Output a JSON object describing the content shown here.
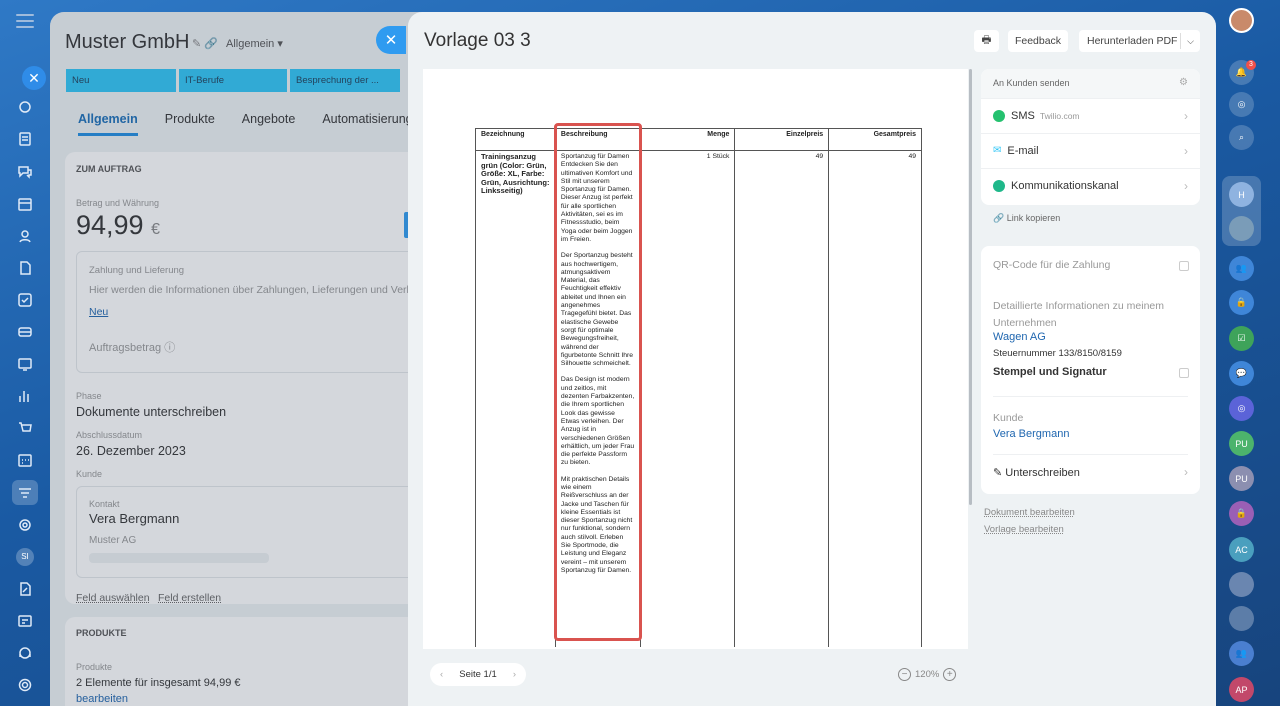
{
  "crm": {
    "title": "Muster GmbH",
    "view": "Allgemein",
    "stages": [
      "Neu",
      "IT-Berufe",
      "Besprechung der ..."
    ],
    "tabs": [
      "Allgemein",
      "Produkte",
      "Angebote",
      "Automatisierung"
    ],
    "order_section": "ZUM AUFTRAG",
    "amount_label": "Betrag und Währung",
    "amount": "94,99",
    "currency": "€",
    "payment_title": "Zahlung und Lieferung",
    "payment_hint": "Hier werden die Informationen über Zahlungen, Lieferungen und Verk",
    "payment_new": "Neu",
    "order_amount_label": "Auftragsbetrag",
    "phase_label": "Phase",
    "phase": "Dokumente unterschreiben",
    "close_date_label": "Abschlussdatum",
    "close_date": "26. Dezember 2023",
    "customer_label": "Kunde",
    "contact_label": "Kontakt",
    "contact_name": "Vera Bergmann",
    "company": "Muster AG",
    "select_field": "Feld auswählen",
    "create_field": "Feld erstellen",
    "products_section": "PRODUKTE",
    "products_label": "Produkte",
    "products_summary": "2 Elemente für insgesamt 94,99 €",
    "products_edit": "bearbeiten"
  },
  "modal": {
    "title": "Vorlage 03 3",
    "feedback": "Feedback",
    "download": "Herunterladen PDF",
    "pager": "Seite 1/1",
    "zoom": "120%"
  },
  "document": {
    "headers": [
      "Bezeichnung",
      "Beschreibung",
      "Menge",
      "Einzelpreis",
      "Gesamtpreis"
    ],
    "item_name": "Trainingsanzug grün (Color: Grün, Größe: XL, Farbe: Grün, Ausrichtung: Linksseitig)",
    "quantity": "1 Stück",
    "unit_price": "49",
    "total_price": "49",
    "description": [
      "Sportanzug für Damen\n Entdecken Sie den ultimativen Komfort und Stil mit unserem Sportanzug für Damen. Dieser Anzug ist perfekt für alle sportlichen Aktivitäten, sei es im Fitnessstudio, beim Yoga oder beim Joggen im Freien.",
      " Der Sportanzug besteht aus hochwertigem, atmungsaktivem Material, das Feuchtigkeit effektiv ableitet und Ihnen ein angenehmes Tragegefühl bietet. Das elastische Gewebe sorgt für optimale Bewegungsfreiheit, während der figurbetonte Schnitt Ihre Silhouette schmeichelt.",
      " Das Design ist modern und zeitlos, mit dezenten Farbakzenten, die Ihrem sportlichen Look das gewisse Etwas verleihen. Der Anzug ist in verschiedenen Größen erhältlich, um jeder Frau die perfekte Passform zu bieten.",
      " Mit praktischen Details wie einem Reißverschluss an der Jacke und Taschen für kleine Essentials ist dieser Sportanzug nicht nur funktional, sondern auch stilvoll. Erleben Sie Sportmode, die Leistung und Eleganz vereint – mit unserem Sportanzug für Damen."
    ]
  },
  "send": {
    "title": "An Kunden senden",
    "sms": "SMS",
    "sms_provider": "Twilio.com",
    "email": "E-mail",
    "channel": "Kommunikationskanal",
    "copy_link": "Link kopieren"
  },
  "details": {
    "qr": "QR-Code für die Zahlung",
    "company_info": "Detaillierte Informationen zu meinem Unternehmen",
    "company_name": "Wagen AG",
    "tax_number": "Steuernummer 133/8150/8159",
    "stamp": "Stempel und Signatur",
    "customer_label": "Kunde",
    "customer": "Vera Bergmann",
    "sign": "Unterschreiben",
    "edit_document": "Dokument bearbeiten",
    "edit_template": "Vorlage bearbeiten"
  },
  "rightnav": {
    "notifications": "3",
    "avatars": [
      "H",
      "PU",
      "PU",
      "AC",
      "AP"
    ]
  },
  "leftnav": {
    "badge": "SI"
  }
}
